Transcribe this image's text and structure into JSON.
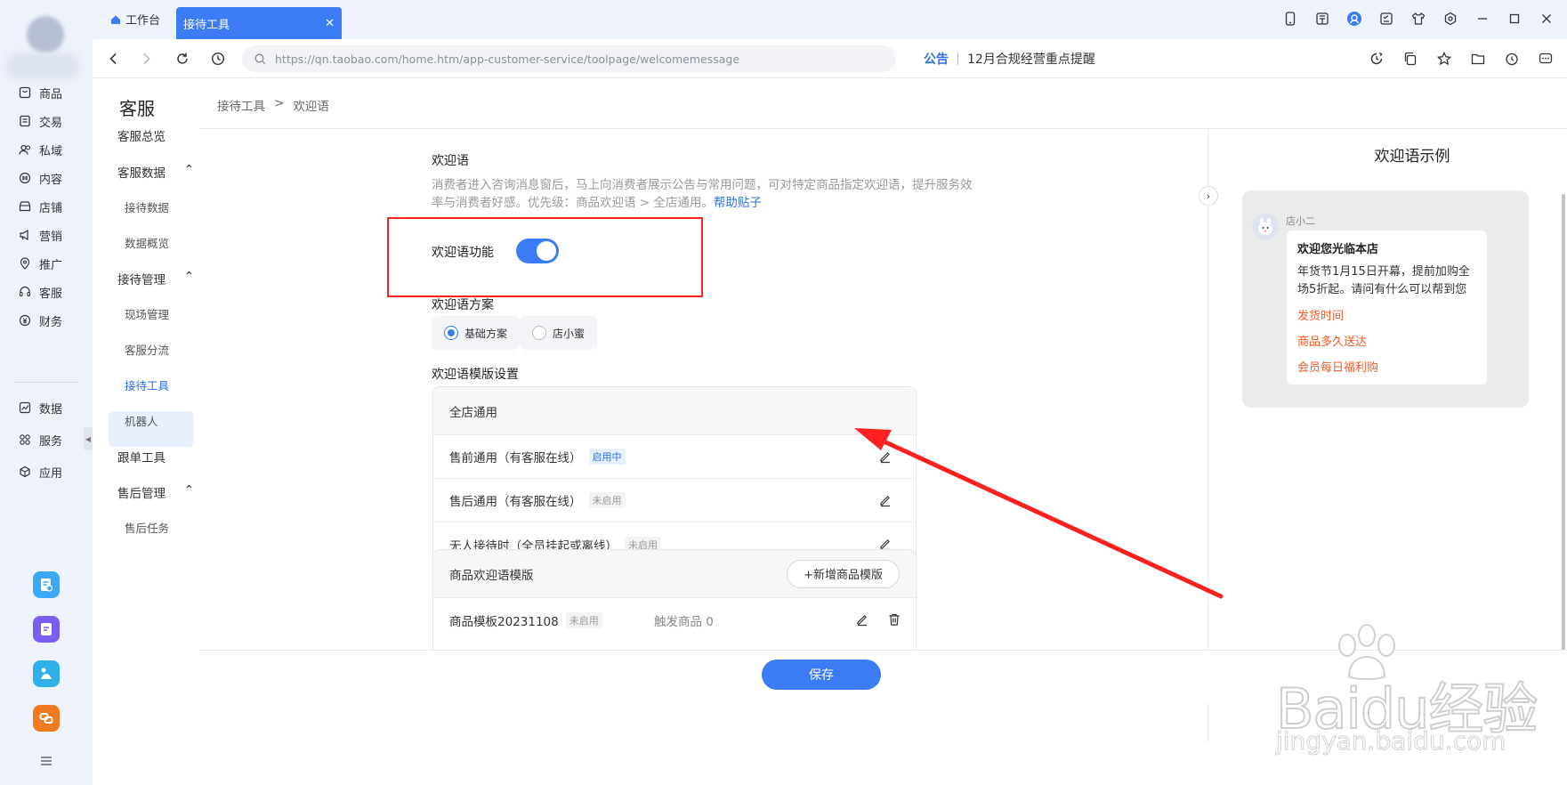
{
  "rail": {
    "items": [
      {
        "label": "商品",
        "icon": "product-icon"
      },
      {
        "label": "交易",
        "icon": "order-icon"
      },
      {
        "label": "私域",
        "icon": "users-icon"
      },
      {
        "label": "内容",
        "icon": "content-icon"
      },
      {
        "label": "店铺",
        "icon": "shop-icon"
      },
      {
        "label": "营销",
        "icon": "megaphone-icon"
      },
      {
        "label": "推广",
        "icon": "pin-icon"
      },
      {
        "label": "客服",
        "icon": "headset-icon"
      },
      {
        "label": "财务",
        "icon": "money-icon"
      },
      {
        "label": "数据",
        "icon": "chart-icon"
      },
      {
        "label": "服务",
        "icon": "grid-icon"
      },
      {
        "label": "应用",
        "icon": "cube-icon"
      }
    ]
  },
  "tabs": {
    "home": "工作台",
    "active": "接待工具"
  },
  "address": {
    "url": "https://qn.taobao.com/home.htm/app-customer-service/toolpage/welcomemessage",
    "notice_tag": "公告",
    "notice_text": "12月合规经营重点提醒"
  },
  "subnav": {
    "title": "客服",
    "items": {
      "overview": "客服总览",
      "data": "客服数据",
      "data_reception": "接待数据",
      "data_overview": "数据概览",
      "manage": "接待管理",
      "manage_site": "现场管理",
      "manage_route": "客服分流",
      "manage_tools": "接待工具",
      "manage_robot": "机器人",
      "follow": "跟单工具",
      "aftersale": "售后管理",
      "aftersale_task": "售后任务"
    }
  },
  "breadcrumb": {
    "parent": "接待工具",
    "sep": ">",
    "current": "欢迎语"
  },
  "welcome": {
    "title": "欢迎语",
    "desc": "消费者进入咨询消息窗后，马上向消费者展示公告与常用问题，可对特定商品指定欢迎语，提升服务效率与消费者好感。优先级：商品欢迎语 > 全店通用。",
    "help_link": "帮助贴子",
    "toggle_label": "欢迎语功能",
    "toggle_on": true,
    "plan_title": "欢迎语方案",
    "plan_basic": "基础方案",
    "plan_xiaomi": "店小蜜",
    "template_title": "欢迎语模版设置"
  },
  "store_card": {
    "head": "全店通用",
    "rows": [
      {
        "label": "售前通用（有客服在线）",
        "status": "启用中"
      },
      {
        "label": "售后通用（有客服在线）",
        "status": "未启用"
      },
      {
        "label": "无人接待时（全员挂起或离线）",
        "status": "未启用"
      }
    ]
  },
  "product_card": {
    "head": "商品欢迎语模版",
    "add_button": "+新增商品模版",
    "rows": [
      {
        "label": "商品模板20231108",
        "status": "未启用",
        "trigger": "触发商品 0"
      }
    ]
  },
  "footer": {
    "save": "保存"
  },
  "preview": {
    "title": "欢迎语示例",
    "sender": "店小二",
    "heading": "欢迎您光临本店",
    "body": "年货节1月15日开幕，提前加购全场5折起。请问有什么可以帮到您",
    "links": [
      "发货时间",
      "商品多久送达",
      "会员每日福利购"
    ]
  },
  "watermark": {
    "main": "Baidu经验",
    "sub": "jingyan.baidu.com"
  },
  "colors": {
    "accent": "#3b7cf4",
    "annotation": "#ff2020",
    "link_orange": "#f05a28"
  }
}
